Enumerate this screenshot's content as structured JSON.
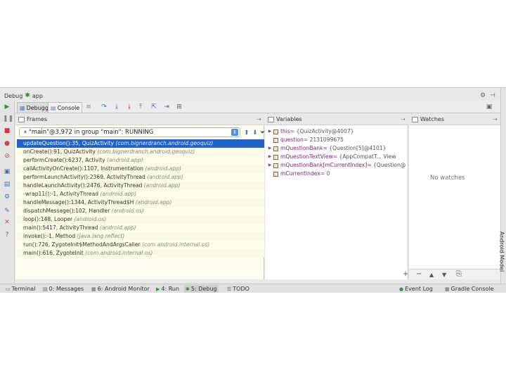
{
  "window": {
    "title": "Debug",
    "config": "app"
  },
  "toolbar": {
    "tab_debugger": "Debugger",
    "tab_console": "Console"
  },
  "frames": {
    "header": "Frames",
    "thread": "\"main\"@3,972 in group \"main\": RUNNING",
    "items": [
      {
        "method": "updateQuestion():35, QuizActivity",
        "pkg": "(com.bignerdranch.android.geoquiz)"
      },
      {
        "method": "onCreate():91, QuizActivity",
        "pkg": "(com.bignerdranch.android.geoquiz)"
      },
      {
        "method": "performCreate():6237, Activity",
        "pkg": "(android.app)"
      },
      {
        "method": "callActivityOnCreate():1107, Instrumentation",
        "pkg": "(android.app)"
      },
      {
        "method": "performLaunchActivity():2369, ActivityThread",
        "pkg": "(android.app)"
      },
      {
        "method": "handleLaunchActivity():2476, ActivityThread",
        "pkg": "(android.app)"
      },
      {
        "method": "-wrap11():-1, ActivityThread",
        "pkg": "(android.app)"
      },
      {
        "method": "handleMessage():1344, ActivityThread$H",
        "pkg": "(android.app)"
      },
      {
        "method": "dispatchMessage():102, Handler",
        "pkg": "(android.os)"
      },
      {
        "method": "loop():148, Looper",
        "pkg": "(android.os)"
      },
      {
        "method": "main():5417, ActivityThread",
        "pkg": "(android.app)"
      },
      {
        "method": "invoke():-1, Method",
        "pkg": "(java.lang.reflect)"
      },
      {
        "method": "run():726, ZygoteInit$MethodAndArgsCaller",
        "pkg": "(com.android.internal.os)"
      },
      {
        "method": "main():616, ZygoteInit",
        "pkg": "(com.android.internal.os)"
      }
    ]
  },
  "variables": {
    "header": "Variables",
    "items": [
      {
        "name": "this",
        "value": " = {QuizActivity@4007}"
      },
      {
        "name": "question",
        "value": " = 2131099675"
      },
      {
        "name": "mQuestionBank",
        "value": " = {Question[5]@4101}"
      },
      {
        "name": "mQuestionTextView",
        "value": " = {AppCompatT... View"
      },
      {
        "name": "mQuestionBank[mCurrentIndex]",
        "value": " = {Question@"
      },
      {
        "name": "mCurrentIndex",
        "value": " = 0"
      }
    ]
  },
  "watches": {
    "header": "Watches",
    "empty": "No watches"
  },
  "right_strip": {
    "label": "Android Model"
  },
  "bottom": {
    "terminal": "Terminal",
    "messages": "0: Messages",
    "monitor": "6: Android Monitor",
    "run": "4: Run",
    "debug": "5: Debug",
    "todo": "TODO",
    "eventlog": "Event Log",
    "gradle": "Gradle Console"
  },
  "colors": {
    "selection": "#1e63c8",
    "frames_bg": "#fffee8"
  }
}
